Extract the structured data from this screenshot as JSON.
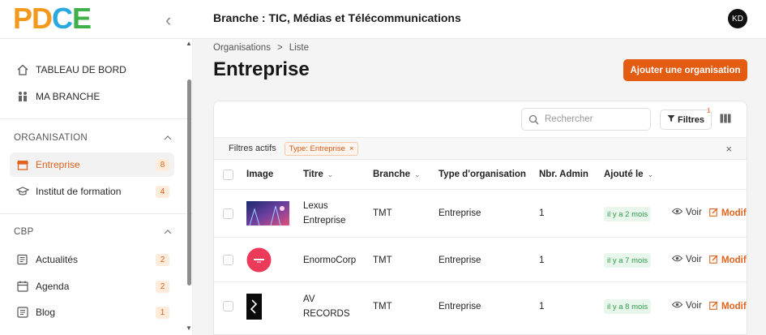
{
  "header": {
    "title": "Branche : TIC, Médias et Télécommunications",
    "avatar": "KD",
    "logo": {
      "p": "P",
      "d": "D",
      "c": "C",
      "e": "E"
    }
  },
  "sidebar": {
    "dashboard": "TABLEAU DE BORD",
    "my_branch": "MA BRANCHE",
    "section_org": "ORGANISATION",
    "org_items": [
      {
        "label": "Entreprise",
        "count": "8"
      },
      {
        "label": "Institut de formation",
        "count": "4"
      }
    ],
    "section_cbp": "CBP",
    "cbp_items": [
      {
        "label": "Actualités",
        "count": "2"
      },
      {
        "label": "Agenda",
        "count": "2"
      },
      {
        "label": "Blog",
        "count": "1"
      }
    ]
  },
  "breadcrumb": {
    "root": "Organisations",
    "sep": ">",
    "current": "Liste"
  },
  "page": {
    "title": "Entreprise",
    "add_button": "Ajouter une organisation"
  },
  "toolbar": {
    "search_placeholder": "Rechercher",
    "filters_label": "Filtres",
    "filters_count": "1"
  },
  "active_filters": {
    "label": "Filtres actifs",
    "chip": "Type: Entreprise",
    "chip_x": "×",
    "clear": "×"
  },
  "table": {
    "headers": {
      "image": "Image",
      "title": "Titre",
      "branch": "Branche",
      "type": "Type d'organisation",
      "admins": "Nbr. Admin",
      "added": "Ajouté le"
    },
    "rows": [
      {
        "title_l1": "Lexus",
        "title_l2": "Entreprise",
        "branch": "TMT",
        "type": "Entreprise",
        "admins": "1",
        "added": "il y a 2 mois",
        "view": "Voir",
        "edit": "Modifi"
      },
      {
        "title_l1": "EnormoCorp",
        "title_l2": "",
        "branch": "TMT",
        "type": "Entreprise",
        "admins": "1",
        "added": "il y a 7 mois",
        "view": "Voir",
        "edit": "Modifi"
      },
      {
        "title_l1": "AV",
        "title_l2": "RECORDS",
        "branch": "TMT",
        "type": "Entreprise",
        "admins": "1",
        "added": "il y a 8 mois",
        "view": "Voir",
        "edit": "Modifi"
      }
    ]
  },
  "colors": {
    "accent": "#e45b12",
    "success": "#2f9b4d"
  },
  "icons": [
    "home-icon",
    "branch-icon",
    "store-icon",
    "graduation-icon",
    "news-icon",
    "calendar-icon",
    "blog-icon",
    "search-icon",
    "filter-icon",
    "columns-icon",
    "eye-icon",
    "edit-icon"
  ]
}
